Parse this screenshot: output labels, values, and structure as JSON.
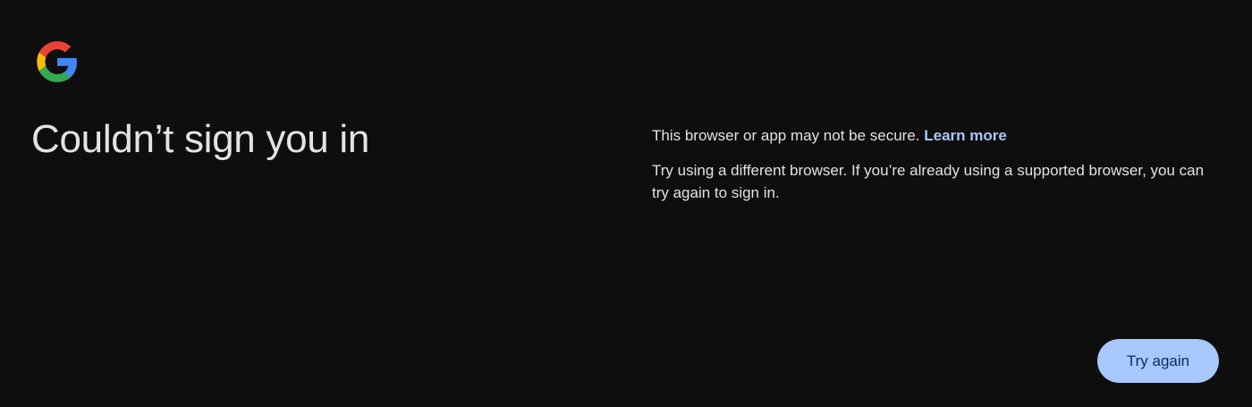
{
  "logo": {
    "icon": "google-g-icon",
    "colors": {
      "red": "#ea4335",
      "yellow": "#fbbc05",
      "green": "#34a853",
      "blue": "#4285f4"
    }
  },
  "heading": {
    "title": "Couldn’t sign you in"
  },
  "message": {
    "line1_text": "This browser or app may not be secure.",
    "learn_more": "Learn more",
    "line2": "Try using a different browser. If you’re already using a supported browser, you can try again to sign in."
  },
  "actions": {
    "try_again_label": "Try again"
  },
  "colors": {
    "background": "#0e0e0f",
    "text": "#e3e3e3",
    "link": "#a8c7fa",
    "button_bg": "#a8c7fa",
    "button_text": "#062e6f"
  }
}
